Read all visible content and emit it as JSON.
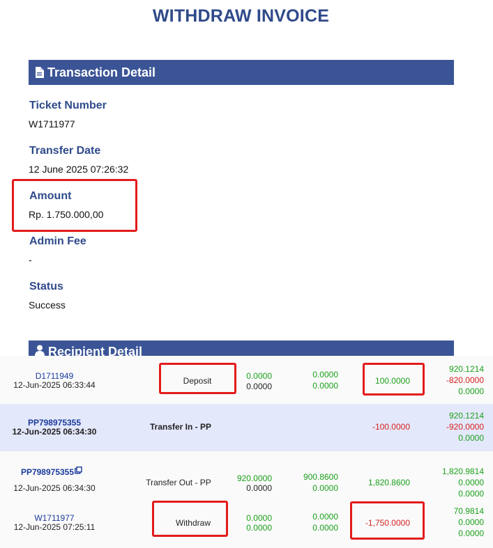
{
  "page": {
    "title": "WITHDRAW INVOICE"
  },
  "transaction_detail": {
    "header": "Transaction Detail",
    "fields": [
      {
        "label": "Ticket Number",
        "value": "W1711977"
      },
      {
        "label": "Transfer Date",
        "value": "12 June 2025 07:26:32"
      },
      {
        "label": "Amount",
        "value": "Rp. 1.750.000,00"
      },
      {
        "label": "Admin Fee",
        "value": "-"
      },
      {
        "label": "Status",
        "value": "Success"
      }
    ]
  },
  "recipient_detail": {
    "header": "Recipient Detail"
  },
  "transactions": [
    {
      "id": "D1711949",
      "date": "12-Jun-2025 06:33:44",
      "type": "Deposit",
      "c1": [
        "0.0000",
        "0.0000"
      ],
      "c2": [
        "0.0000",
        "0.0000"
      ],
      "c3": "100.0000",
      "c4": [
        "920.1214",
        "-820.0000",
        "0.0000"
      ]
    },
    {
      "id": "PP798975355",
      "date": "12-Jun-2025 06:34:30",
      "type": "Transfer In - PP",
      "c1": [
        "",
        ""
      ],
      "c2": [
        "",
        ""
      ],
      "c3": "-100.0000",
      "c4": [
        "920.1214",
        "-920.0000",
        "0.0000"
      ]
    },
    {
      "id": "PP798975355",
      "date": "12-Jun-2025 06:34:30",
      "type": "Transfer Out - PP",
      "c1": [
        "920.0000",
        "0.0000"
      ],
      "c2": [
        "900.8600",
        "0.0000"
      ],
      "c3": "1,820.8600",
      "c4": [
        "1,820.9814",
        "0.0000",
        "0.0000"
      ]
    },
    {
      "id": "W1711977",
      "date": "12-Jun-2025 07:25:11",
      "type": "Withdraw",
      "c1": [
        "0.0000",
        "0.0000"
      ],
      "c2": [
        "0.0000",
        "0.0000"
      ],
      "c3": "-1,750.0000",
      "c4": [
        "70.9814",
        "0.0000",
        "0.0000"
      ]
    }
  ],
  "colors": {
    "accent": "#3b5496",
    "title": "#2f4a8a",
    "positive": "#1aa01a",
    "negative": "#d62020",
    "highlight": "#e31b1b"
  },
  "icons": {
    "transaction_header": "document-icon",
    "recipient_header": "user-icon",
    "copy": "copy-icon"
  }
}
